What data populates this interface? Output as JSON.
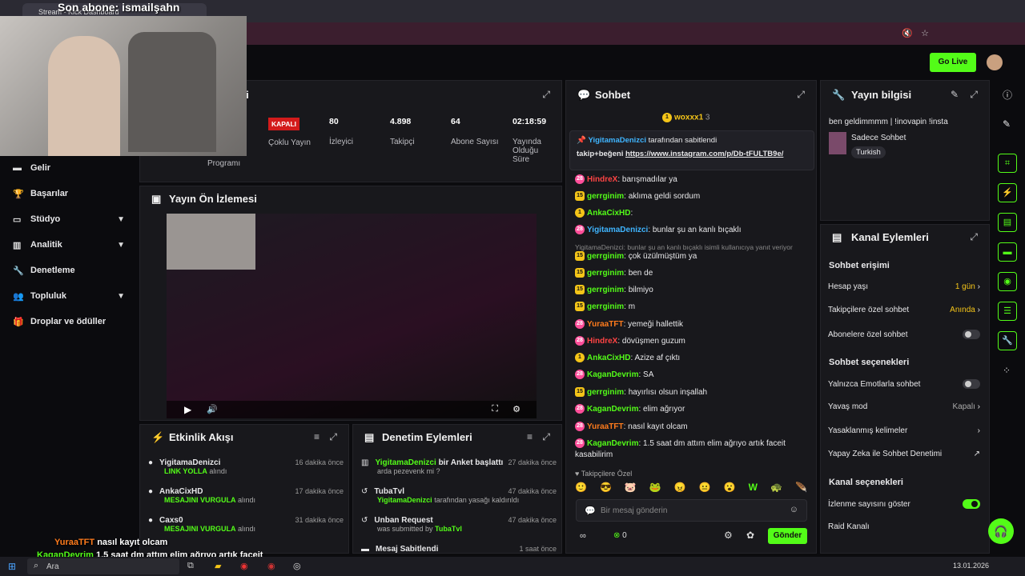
{
  "overlay": {
    "sub_text": "Son abone: ismailşahn"
  },
  "browser": {
    "tab_title": "Stream - Kick Dashboard"
  },
  "topbar": {
    "go_live": "Go Live"
  },
  "sidebar": {
    "items": [
      {
        "label": "Gelir",
        "icon": "dollar-icon"
      },
      {
        "label": "Başarılar",
        "icon": "trophy-icon"
      },
      {
        "label": "Stüdyo",
        "icon": "studio-icon",
        "chev": "▼"
      },
      {
        "label": "Analitik",
        "icon": "chart-icon",
        "chev": "▼"
      },
      {
        "label": "Denetleme",
        "icon": "wrench-icon"
      },
      {
        "label": "Topluluk",
        "icon": "users-icon",
        "chev": "▼"
      },
      {
        "label": "Droplar ve ödüller",
        "icon": "gift-icon"
      }
    ]
  },
  "session": {
    "title_suffix": "eri",
    "program": "Programı",
    "status": "KAPALI",
    "multi": "Çoklu Yayın",
    "viewers_val": "80",
    "viewers_lbl": "İzleyici",
    "followers_val": "4.898",
    "followers_lbl": "Takipçi",
    "subs_val": "64",
    "subs_lbl": "Abone Sayısı",
    "uptime_val": "02:18:59",
    "uptime_lbl": "Yayında Olduğu Süre"
  },
  "preview": {
    "title": "Yayın Ön İzlemesi"
  },
  "activity": {
    "title": "Etkinlik Akışı",
    "items": [
      {
        "name": "YigitamaDenizci",
        "action": "LINK YOLLA",
        "suffix": "alındı",
        "time": "16 dakika önce"
      },
      {
        "name": "AnkaCixHD",
        "action": "MESAJINI VURGULA",
        "suffix": "alındı",
        "time": "17 dakika önce"
      },
      {
        "name": "Caxs0",
        "action": "MESAJINI VURGULA",
        "suffix": "alındı",
        "time": "31 dakika önce"
      }
    ]
  },
  "moderation": {
    "title": "Denetim Eylemleri",
    "items": [
      {
        "line1_name": "YigitamaDenizci",
        "line1": "bir Anket başlattı",
        "line2": "arda pezevenk mi ?",
        "time": "27 dakika önce"
      },
      {
        "line1_name": "TubaTvl",
        "line1": "",
        "line2_name": "YigitamaDenizci",
        "line2": "tarafından yasağı kaldırıldı",
        "time": "47 dakika önce"
      },
      {
        "line1_name": "Unban Request",
        "line1": "",
        "line2": "was submitted by",
        "line2_name": "TubaTvl",
        "time": "47 dakika önce"
      },
      {
        "line1_name": "Mesaj Sabitlendi",
        "line1": "",
        "time": "1 saat önce"
      }
    ]
  },
  "chat": {
    "title": "Sohbet",
    "top_user": "woxxx1",
    "top_count": "3",
    "pinned_by": "YigitamaDenizci",
    "pinned_label": "tarafından sabitlendi",
    "pinned_text": "takip+beğeni",
    "pinned_link": "https://www.instagram.com/p/Db-tFULTB9e/",
    "messages": [
      {
        "badge": "28",
        "user": "HindreX",
        "color": "#ff4444",
        "text": "barışmadılar ya"
      },
      {
        "badge": "15",
        "user": "gerrginim",
        "color": "#53fc18",
        "text": "aklıma geldi sordum"
      },
      {
        "badge": "1",
        "user": "AnkaCixHD",
        "color": "#53fc18",
        "text": ""
      },
      {
        "badge": "28",
        "user": "YigitamaDenizci",
        "color": "#3fb5ff",
        "text": "bunlar şu an kanlı bıçaklı"
      },
      {
        "badge": "15",
        "user": "gerrginim",
        "color": "#53fc18",
        "text": "çok üzülmüştüm ya",
        "reply": "YigitamaDenizci: bunlar şu an kanlı bıçaklı isimli kullanıcıya yanıt veriyor"
      },
      {
        "badge": "15",
        "user": "gerrginim",
        "color": "#53fc18",
        "text": "ben de"
      },
      {
        "badge": "15",
        "user": "gerrginim",
        "color": "#53fc18",
        "text": "bilmiyo"
      },
      {
        "badge": "15",
        "user": "gerrginim",
        "color": "#53fc18",
        "text": "m"
      },
      {
        "badge": "28",
        "user": "YuraaTFT",
        "color": "#ff7b1c",
        "text": "yemeği hallettik"
      },
      {
        "badge": "28",
        "user": "HindreX",
        "color": "#ff4444",
        "text": "dövüşmen guzum"
      },
      {
        "badge": "1",
        "user": "AnkaCixHD",
        "color": "#53fc18",
        "text": "Azize af çıktı"
      },
      {
        "badge": "28",
        "user": "KaganDevrim",
        "color": "#53fc18",
        "text": "SA"
      },
      {
        "badge": "15",
        "user": "gerrginim",
        "color": "#53fc18",
        "text": "hayırlısı olsun inşallah"
      },
      {
        "badge": "28",
        "user": "KaganDevrim",
        "color": "#53fc18",
        "text": "elim ağrıyor"
      },
      {
        "badge": "28",
        "user": "YuraaTFT",
        "color": "#ff7b1c",
        "text": "nasıl kayıt olcam"
      },
      {
        "badge": "28",
        "user": "KaganDevrim",
        "color": "#53fc18",
        "text": "1.5 saat dm attım elim ağrıyo artık faceit kasabilirim"
      }
    ],
    "emote_label": "Takipçilere Özel",
    "input_placeholder": "Bir mesaj gönderin",
    "points": "0",
    "send": "Gönder"
  },
  "info": {
    "title": "Yayın bilgisi",
    "stream_title": "ben geldimmmm | !inovapin !insta",
    "category": "Sadece Sohbet",
    "tag": "Turkish"
  },
  "channel_actions": {
    "title": "Kanal Eylemleri",
    "chat_access": "Sohbet erişimi",
    "account_age": "Hesap yaşı",
    "account_age_val": "1 gün",
    "followers_only": "Takipçilere özel sohbet",
    "followers_only_val": "Anında",
    "subs_only": "Abonelere özel sohbet",
    "chat_options": "Sohbet seçenekleri",
    "emote_only": "Yalnızca Emotlarla sohbet",
    "slow_mode": "Yavaş mod",
    "slow_mode_val": "Kapalı",
    "banned_words": "Yasaklanmış kelimeler",
    "ai_moderation": "Yapay Zeka ile Sohbet Denetimi",
    "channel_options": "Kanal seçenekleri",
    "show_viewers": "İzlenme sayısını göster",
    "raid": "Raid Kanalı"
  },
  "overlay_chat": [
    {
      "user": "YuraaTFT",
      "text": "nasıl kayıt olcam"
    },
    {
      "user": "KaganDevrim",
      "text": "1.5 saat dm attım elim ağrıyo artık faceit kasabilirim"
    }
  ],
  "taskbar": {
    "search": "Ara",
    "date": "13.01.2026"
  }
}
